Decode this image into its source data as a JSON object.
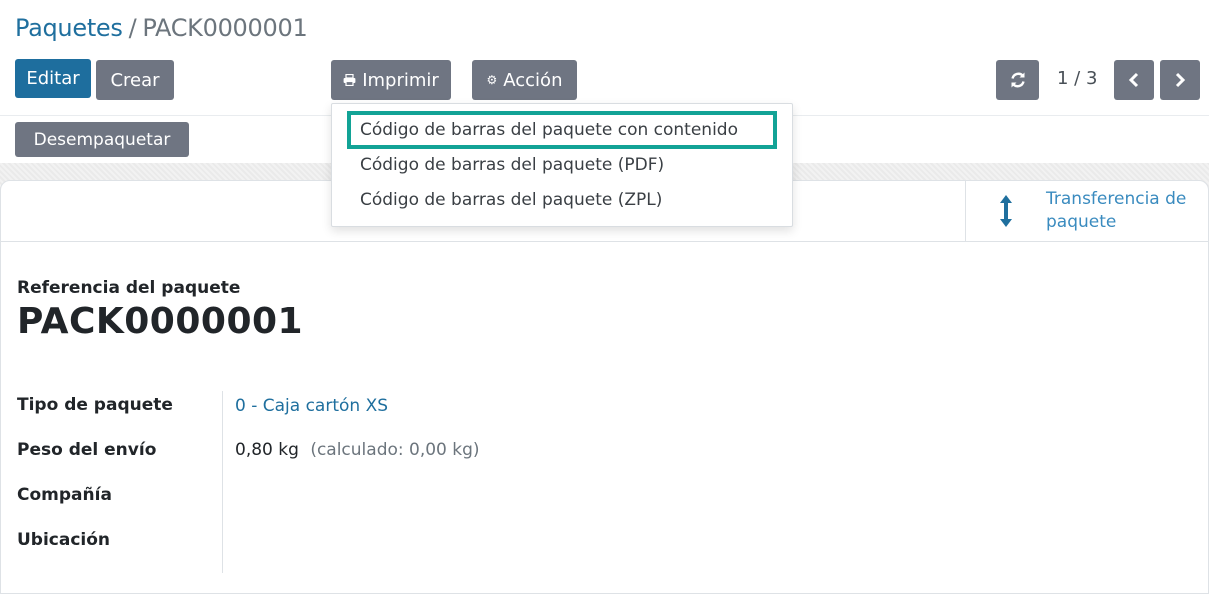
{
  "breadcrumb": {
    "parent": "Paquetes",
    "separator": "/",
    "current": "PACK0000001"
  },
  "toolbar": {
    "edit_label": "Editar",
    "create_label": "Crear",
    "print_label": "Imprimir",
    "print_icon": "printer-icon",
    "action_label": "Acción",
    "action_icon": "gear-icon",
    "refresh_icon": "refresh-icon",
    "pager": "1 / 3",
    "prev_icon": "chevron-left-icon",
    "next_icon": "chevron-right-icon"
  },
  "print_menu": {
    "items": [
      "Código de barras del paquete con contenido",
      "Código de barras del paquete (PDF)",
      "Código de barras del paquete (ZPL)"
    ],
    "highlight_color": "#12a396"
  },
  "statusbar": {
    "unpack_label": "Desempaquetar"
  },
  "smart_button": {
    "icon": "arrows-vertical-icon",
    "label_line1": "Transferencia de",
    "label_line2": "paquete"
  },
  "form": {
    "reference_label": "Referencia del paquete",
    "reference_value": "PACK0000001",
    "fields": [
      {
        "label": "Tipo de paquete",
        "value": "0 - Caja cartón XS"
      },
      {
        "label": "Peso del envío",
        "value": "0,80 kg",
        "extra": "(calculado: 0,00 kg)"
      },
      {
        "label": "Compañía",
        "value": ""
      },
      {
        "label": "Ubicación",
        "value": ""
      }
    ]
  },
  "colors": {
    "primary": "#1e6e9e",
    "secondary": "#6f7582",
    "link": "#1f6f9e"
  }
}
